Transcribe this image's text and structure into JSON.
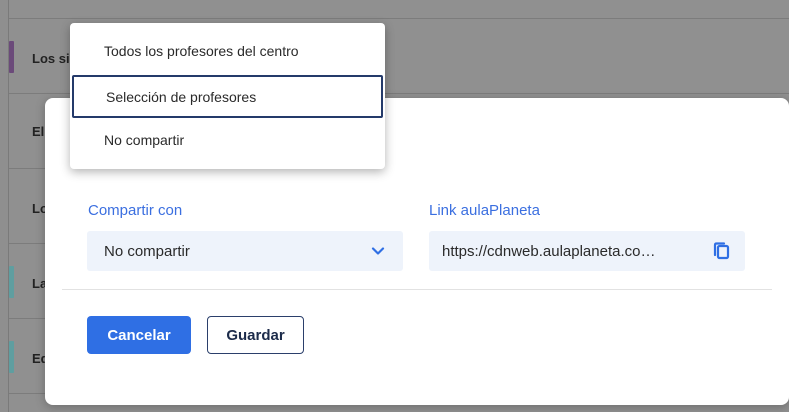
{
  "background_list": {
    "rows": [
      {
        "title": "Los si"
      },
      {
        "title": "El"
      },
      {
        "title": "Lo"
      },
      {
        "title": "La"
      },
      {
        "title": "Ed"
      }
    ]
  },
  "modal": {
    "share": {
      "label": "Compartir con",
      "value": "No compartir"
    },
    "link": {
      "label": "Link aulaPlaneta",
      "value": "https://cdnweb.aulaplaneta.co…"
    },
    "buttons": {
      "cancel": "Cancelar",
      "save": "Guardar"
    }
  },
  "dropdown": {
    "options": [
      {
        "label": "Todos los profesores del centro"
      },
      {
        "label": "Selección de profesores",
        "focused": true
      },
      {
        "label": "No compartir"
      }
    ]
  },
  "colors": {
    "accent": "#2f6fe4",
    "label_blue": "#3b6fe0",
    "field_bg": "#eef3fb",
    "focus_border": "#243a6a"
  },
  "icons": {
    "select_chevron": "chevron-down-icon",
    "copy": "copy-icon"
  }
}
